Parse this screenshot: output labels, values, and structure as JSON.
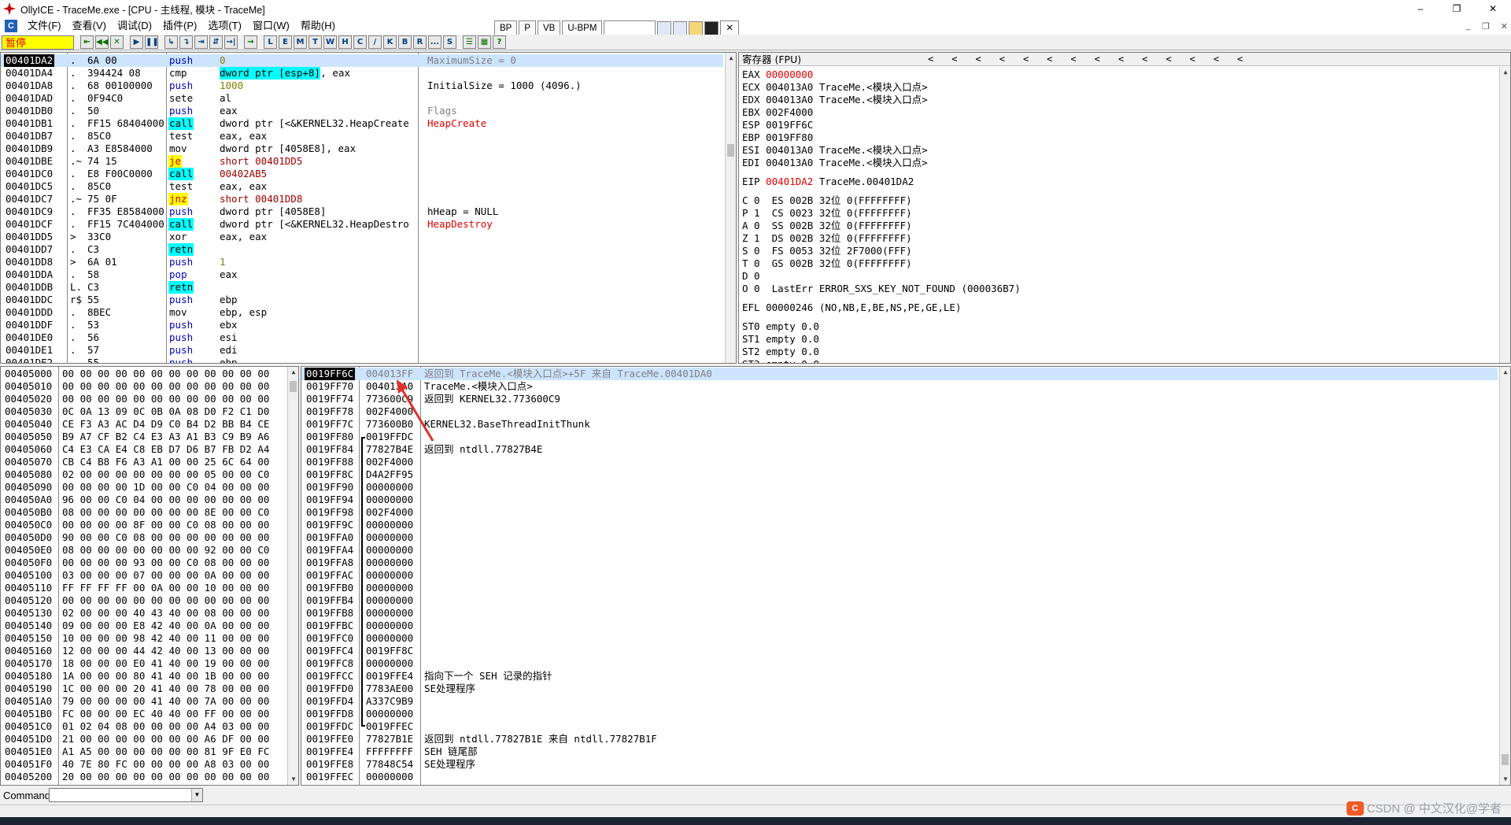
{
  "window": {
    "title": "OllyICE - TraceMe.exe - [CPU - 主线程, 模块 - TraceMe]",
    "min": "–",
    "max": "❐",
    "close": "✕"
  },
  "menu": {
    "items": [
      "文件(F)",
      "查看(V)",
      "调试(D)",
      "插件(P)",
      "选项(T)",
      "窗口(W)",
      "帮助(H)"
    ],
    "mdi": [
      "_",
      "❐",
      "✕"
    ]
  },
  "mini_toolbar": {
    "bp": "BP",
    "p": "P",
    "vb": "VB",
    "ubpm": "U-BPM",
    "close": "✕"
  },
  "toolbar": {
    "status": "暂停",
    "buttons_a": [
      "⇤",
      "◀◀",
      "✕"
    ],
    "buttons_b": [
      "▶",
      "❚❚"
    ],
    "buttons_c": [
      "↳",
      "↴",
      "⇥",
      "⇵",
      "→|"
    ],
    "buttons_d": [
      "→"
    ],
    "letters": [
      "L",
      "E",
      "M",
      "T",
      "W",
      "H",
      "C",
      "/",
      "K",
      "B",
      "R",
      "...",
      "S"
    ],
    "buttons_e": [
      "☰",
      "▦",
      "?"
    ]
  },
  "disasm": {
    "rows": [
      {
        "addr": "00401DA2",
        "mark": ".",
        "hex": "6A 00",
        "op": "push",
        "args": "0",
        "sel": true,
        "opcls": "c-blue",
        "argcls": "c-olive"
      },
      {
        "addr": "00401DA4",
        "mark": ".",
        "hex": "394424 08",
        "op": "cmp",
        "args_hl": "dword ptr [esp+8]",
        "args": ", eax"
      },
      {
        "addr": "00401DA8",
        "mark": ".",
        "hex": "68 00100000",
        "op": "push",
        "args": "1000",
        "opcls": "c-blue",
        "argcls": "c-olive"
      },
      {
        "addr": "00401DAD",
        "mark": ".",
        "hex": "0F94C0",
        "op": "sete",
        "args": "al"
      },
      {
        "addr": "00401DB0",
        "mark": ".",
        "hex": "50",
        "op": "push",
        "args": "eax",
        "opcls": "c-blue"
      },
      {
        "addr": "00401DB1",
        "mark": ".",
        "hex": "FF15 68404000",
        "op": "call",
        "args": "dword ptr [<&KERNEL32.HeapCreate",
        "opcls": "hl-call"
      },
      {
        "addr": "00401DB7",
        "mark": ".",
        "hex": "85C0",
        "op": "test",
        "args": "eax, eax"
      },
      {
        "addr": "00401DB9",
        "mark": ".",
        "hex": "A3 E8584000",
        "op": "mov",
        "args": "dword ptr [4058E8], eax"
      },
      {
        "addr": "00401DBE",
        "mark": ".~",
        "hex": "74 15",
        "op": "je",
        "args": "short 00401DD5",
        "opcls": "hl-jmp",
        "argcls": "c-darkred"
      },
      {
        "addr": "00401DC0",
        "mark": ".",
        "hex": "E8 F00C0000",
        "op": "call",
        "args": "00402AB5",
        "opcls": "hl-call",
        "argcls": "c-darkred"
      },
      {
        "addr": "00401DC5",
        "mark": ".",
        "hex": "85C0",
        "op": "test",
        "args": "eax, eax"
      },
      {
        "addr": "00401DC7",
        "mark": ".~",
        "hex": "75 0F",
        "op": "jnz",
        "args": "short 00401DD8",
        "opcls": "hl-jmp",
        "argcls": "c-darkred"
      },
      {
        "addr": "00401DC9",
        "mark": ".",
        "hex": "FF35 E8584000",
        "op": "push",
        "args": "dword ptr [4058E8]",
        "opcls": "c-blue"
      },
      {
        "addr": "00401DCF",
        "mark": ".",
        "hex": "FF15 7C404000",
        "op": "call",
        "args": "dword ptr [<&KERNEL32.HeapDestro",
        "opcls": "hl-call"
      },
      {
        "addr": "00401DD5",
        "mark": ">",
        "hex": "33C0",
        "op": "xor",
        "args": "eax, eax"
      },
      {
        "addr": "00401DD7",
        "mark": ".",
        "hex": "C3",
        "op": "retn",
        "args": "",
        "opcls": "hl-ret"
      },
      {
        "addr": "00401DD8",
        "mark": ">",
        "hex": "6A 01",
        "op": "push",
        "args": "1",
        "opcls": "c-blue",
        "argcls": "c-olive"
      },
      {
        "addr": "00401DDA",
        "mark": ".",
        "hex": "58",
        "op": "pop",
        "args": "eax",
        "opcls": "c-blue"
      },
      {
        "addr": "00401DDB",
        "mark": "L.",
        "hex": "C3",
        "op": "retn",
        "args": "",
        "opcls": "hl-ret"
      },
      {
        "addr": "00401DDC",
        "mark": "r$",
        "hex": "55",
        "op": "push",
        "args": "ebp",
        "opcls": "c-blue"
      },
      {
        "addr": "00401DDD",
        "mark": ".",
        "hex": "8BEC",
        "op": "mov",
        "args": "ebp, esp"
      },
      {
        "addr": "00401DDF",
        "mark": ".",
        "hex": "53",
        "op": "push",
        "args": "ebx",
        "opcls": "c-blue"
      },
      {
        "addr": "00401DE0",
        "mark": ".",
        "hex": "56",
        "op": "push",
        "args": "esi",
        "opcls": "c-blue"
      },
      {
        "addr": "00401DE1",
        "mark": ".",
        "hex": "57",
        "op": "push",
        "args": "edi",
        "opcls": "c-blue"
      },
      {
        "addr": "00401DE2",
        "mark": ".",
        "hex": "55",
        "op": "push",
        "args": "ebp",
        "opcls": "c-blue"
      }
    ],
    "comments": [
      {
        "row": 0,
        "text": "MaximumSize = 0",
        "cls": "c-gray"
      },
      {
        "row": 2,
        "text": "InitialSize = 1000 (4096.)",
        "cls": ""
      },
      {
        "row": 4,
        "text": "Flags",
        "cls": "c-gray"
      },
      {
        "row": 5,
        "text": "HeapCreate",
        "cls": "c-red"
      },
      {
        "row": 12,
        "text": "hHeap = NULL",
        "cls": ""
      },
      {
        "row": 13,
        "text": "HeapDestroy",
        "cls": "c-red"
      }
    ]
  },
  "registers": {
    "header": "寄存器 (FPU)",
    "arrows": [
      "<",
      "<",
      "<",
      "<",
      "<",
      "<",
      "<",
      "<",
      "<",
      "<",
      "<",
      "<",
      "<",
      "<"
    ],
    "rows": [
      {
        "label": "EAX ",
        "val": "00000000",
        "red": true,
        "rest": ""
      },
      {
        "label": "ECX ",
        "val": "004013A0",
        "rest": " TraceMe.<模块入口点>"
      },
      {
        "label": "EDX ",
        "val": "004013A0",
        "rest": " TraceMe.<模块入口点>"
      },
      {
        "label": "EBX ",
        "val": "002F4000",
        "rest": ""
      },
      {
        "label": "ESP ",
        "val": "0019FF6C",
        "rest": ""
      },
      {
        "label": "EBP ",
        "val": "0019FF80",
        "rest": ""
      },
      {
        "label": "ESI ",
        "val": "004013A0",
        "rest": " TraceMe.<模块入口点>"
      },
      {
        "label": "EDI ",
        "val": "004013A0",
        "rest": " TraceMe.<模块入口点>"
      },
      {
        "spacer": true
      },
      {
        "label": "EIP ",
        "val": "00401DA2",
        "red": true,
        "rest": " TraceMe.00401DA2"
      },
      {
        "spacer": true
      },
      {
        "label": "C 0  ",
        "val": "ES 002B",
        "rest": " 32位 0(FFFFFFFF)"
      },
      {
        "label": "P 1  ",
        "val": "CS 0023",
        "rest": " 32位 0(FFFFFFFF)"
      },
      {
        "label": "A 0  ",
        "val": "SS 002B",
        "rest": " 32位 0(FFFFFFFF)"
      },
      {
        "label": "Z 1  ",
        "val": "DS 002B",
        "rest": " 32位 0(FFFFFFFF)"
      },
      {
        "label": "S 0  ",
        "val": "FS 0053",
        "rest": " 32位 2F7000(FFF)"
      },
      {
        "label": "T 0  ",
        "val": "GS 002B",
        "rest": " 32位 0(FFFFFFFF)"
      },
      {
        "label": "D 0",
        "val": "",
        "rest": ""
      },
      {
        "label": "O 0  ",
        "val": "LastErr",
        "rest": " ERROR_SXS_KEY_NOT_FOUND (000036B7)"
      },
      {
        "spacer": true
      },
      {
        "label": "EFL ",
        "val": "00000246",
        "rest": " (NO,NB,E,BE,NS,PE,GE,LE)"
      },
      {
        "spacer": true
      },
      {
        "label": "ST0 ",
        "val": "empty",
        "rest": " 0.0"
      },
      {
        "label": "ST1 ",
        "val": "empty",
        "rest": " 0.0"
      },
      {
        "label": "ST2 ",
        "val": "empty",
        "rest": " 0.0"
      },
      {
        "label": "ST3 ",
        "val": "empty",
        "rest": " 0.0"
      }
    ]
  },
  "dump": {
    "rows": [
      {
        "addr": "00405000",
        "hex": "00 00 00 00 00 00 00 00 00 00 00 00"
      },
      {
        "addr": "00405010",
        "hex": "00 00 00 00 00 00 00 00 00 00 00 00"
      },
      {
        "addr": "00405020",
        "hex": "00 00 00 00 00 00 00 00 00 00 00 00"
      },
      {
        "addr": "00405030",
        "hex": "0C 0A 13 09 0C 0B 0A 08 D0 F2 C1 D0"
      },
      {
        "addr": "00405040",
        "hex": "CE F3 A3 AC D4 D9 C0 B4 D2 BB B4 CE"
      },
      {
        "addr": "00405050",
        "hex": "B9 A7 CF B2 C4 E3 A3 A1 B3 C9 B9 A6"
      },
      {
        "addr": "00405060",
        "hex": "C4 E3 CA E4 C8 EB D7 D6 B7 FB D2 A4"
      },
      {
        "addr": "00405070",
        "hex": "CB C4 B8 F6 A3 A1 00 00 25 6C 64 00"
      },
      {
        "addr": "00405080",
        "hex": "02 00 00 00 00 00 00 00 05 00 00 C0"
      },
      {
        "addr": "00405090",
        "hex": "00 00 00 00 1D 00 00 C0 04 00 00 00"
      },
      {
        "addr": "004050A0",
        "hex": "96 00 00 C0 04 00 00 00 00 00 00 00"
      },
      {
        "addr": "004050B0",
        "hex": "08 00 00 00 00 00 00 00 8E 00 00 C0"
      },
      {
        "addr": "004050C0",
        "hex": "00 00 00 00 8F 00 00 C0 08 00 00 00"
      },
      {
        "addr": "004050D0",
        "hex": "90 00 00 C0 08 00 00 00 00 00 00 00"
      },
      {
        "addr": "004050E0",
        "hex": "08 00 00 00 00 00 00 00 92 00 00 C0"
      },
      {
        "addr": "004050F0",
        "hex": "00 00 00 00 93 00 00 C0 08 00 00 00"
      },
      {
        "addr": "00405100",
        "hex": "03 00 00 00 07 00 00 00 0A 00 00 00"
      },
      {
        "addr": "00405110",
        "hex": "FF FF FF FF 00 0A 00 00 10 00 00 00"
      },
      {
        "addr": "00405120",
        "hex": "00 00 00 00 00 00 00 00 00 00 00 00"
      },
      {
        "addr": "00405130",
        "hex": "02 00 00 00 40 43 40 00 08 00 00 00"
      },
      {
        "addr": "00405140",
        "hex": "09 00 00 00 E8 42 40 00 0A 00 00 00"
      },
      {
        "addr": "00405150",
        "hex": "10 00 00 00 98 42 40 00 11 00 00 00"
      },
      {
        "addr": "00405160",
        "hex": "12 00 00 00 44 42 40 00 13 00 00 00"
      },
      {
        "addr": "00405170",
        "hex": "18 00 00 00 E0 41 40 00 19 00 00 00"
      },
      {
        "addr": "00405180",
        "hex": "1A 00 00 00 80 41 40 00 1B 00 00 00"
      },
      {
        "addr": "00405190",
        "hex": "1C 00 00 00 20 41 40 00 78 00 00 00"
      },
      {
        "addr": "004051A0",
        "hex": "79 00 00 00 00 41 40 00 7A 00 00 00"
      },
      {
        "addr": "004051B0",
        "hex": "FC 00 00 00 EC 40 40 00 FF 00 00 00"
      },
      {
        "addr": "004051C0",
        "hex": "01 02 04 08 00 00 00 00 A4 03 00 00"
      },
      {
        "addr": "004051D0",
        "hex": "21 00 00 00 00 00 00 00 A6 DF 00 00"
      },
      {
        "addr": "004051E0",
        "hex": "A1 A5 00 00 00 00 00 00 81 9F E0 FC"
      },
      {
        "addr": "004051F0",
        "hex": "40 7E 80 FC 00 00 00 00 A8 03 00 00"
      },
      {
        "addr": "00405200",
        "hex": "20 00 00 00 00 00 00 00 00 00 00 00"
      }
    ]
  },
  "stack": {
    "rows": [
      {
        "addr": "0019FF6C",
        "val": "004013FF",
        "cmt": "返回到 TraceMe.<模块入口点>+5F 来自 TraceMe.00401DA0",
        "sel": true
      },
      {
        "addr": "0019FF70",
        "val": "004013A0",
        "cmt": "TraceMe.<模块入口点>"
      },
      {
        "addr": "0019FF74",
        "val": "773600C9",
        "cmt": "返回到 KERNEL32.773600C9"
      },
      {
        "addr": "0019FF78",
        "val": "002F4000",
        "cmt": ""
      },
      {
        "addr": "0019FF7C",
        "val": "773600B0",
        "cmt": "KERNEL32.BaseThreadInitThunk"
      },
      {
        "addr": "0019FF80",
        "val": "0019FFDC",
        "cmt": "",
        "br": "top"
      },
      {
        "addr": "0019FF84",
        "val": "77827B4E",
        "cmt": "返回到 ntdll.77827B4E"
      },
      {
        "addr": "0019FF88",
        "val": "002F4000",
        "cmt": ""
      },
      {
        "addr": "0019FF8C",
        "val": "D4A2FF95",
        "cmt": ""
      },
      {
        "addr": "0019FF90",
        "val": "00000000",
        "cmt": ""
      },
      {
        "addr": "0019FF94",
        "val": "00000000",
        "cmt": ""
      },
      {
        "addr": "0019FF98",
        "val": "002F4000",
        "cmt": ""
      },
      {
        "addr": "0019FF9C",
        "val": "00000000",
        "cmt": ""
      },
      {
        "addr": "0019FFA0",
        "val": "00000000",
        "cmt": ""
      },
      {
        "addr": "0019FFA4",
        "val": "00000000",
        "cmt": ""
      },
      {
        "addr": "0019FFA8",
        "val": "00000000",
        "cmt": ""
      },
      {
        "addr": "0019FFAC",
        "val": "00000000",
        "cmt": ""
      },
      {
        "addr": "0019FFB0",
        "val": "00000000",
        "cmt": ""
      },
      {
        "addr": "0019FFB4",
        "val": "00000000",
        "cmt": ""
      },
      {
        "addr": "0019FFB8",
        "val": "00000000",
        "cmt": ""
      },
      {
        "addr": "0019FFBC",
        "val": "00000000",
        "cmt": ""
      },
      {
        "addr": "0019FFC0",
        "val": "00000000",
        "cmt": ""
      },
      {
        "addr": "0019FFC4",
        "val": "0019FF8C",
        "cmt": ""
      },
      {
        "addr": "0019FFC8",
        "val": "00000000",
        "cmt": ""
      },
      {
        "addr": "0019FFCC",
        "val": "0019FFE4",
        "cmt": "指向下一个 SEH 记录的指针"
      },
      {
        "addr": "0019FFD0",
        "val": "7783AE00",
        "cmt": "SE处理程序"
      },
      {
        "addr": "0019FFD4",
        "val": "A337C9B9",
        "cmt": ""
      },
      {
        "addr": "0019FFD8",
        "val": "00000000",
        "cmt": ""
      },
      {
        "addr": "0019FFDC",
        "val": "0019FFEC",
        "cmt": "",
        "br": "bottom"
      },
      {
        "addr": "0019FFE0",
        "val": "77827B1E",
        "cmt": "返回到 ntdll.77827B1E 来自 ntdll.77827B1F"
      },
      {
        "addr": "0019FFE4",
        "val": "FFFFFFFF",
        "cmt": "SEH 链尾部"
      },
      {
        "addr": "0019FFE8",
        "val": "77848C54",
        "cmt": "SE处理程序"
      },
      {
        "addr": "0019FFEC",
        "val": "00000000",
        "cmt": ""
      }
    ]
  },
  "command": {
    "label": "Command",
    "value": "",
    "dd": "▼"
  },
  "watermark": {
    "logo": "C",
    "text": "CSDN @ 中文汉化@学者"
  },
  "colors": {
    "selection": "#000000",
    "call_bg": "#00ffff",
    "jump_bg": "#ffff00",
    "paused_bg": "#ffff00",
    "annot_arrow": "#e03030"
  }
}
